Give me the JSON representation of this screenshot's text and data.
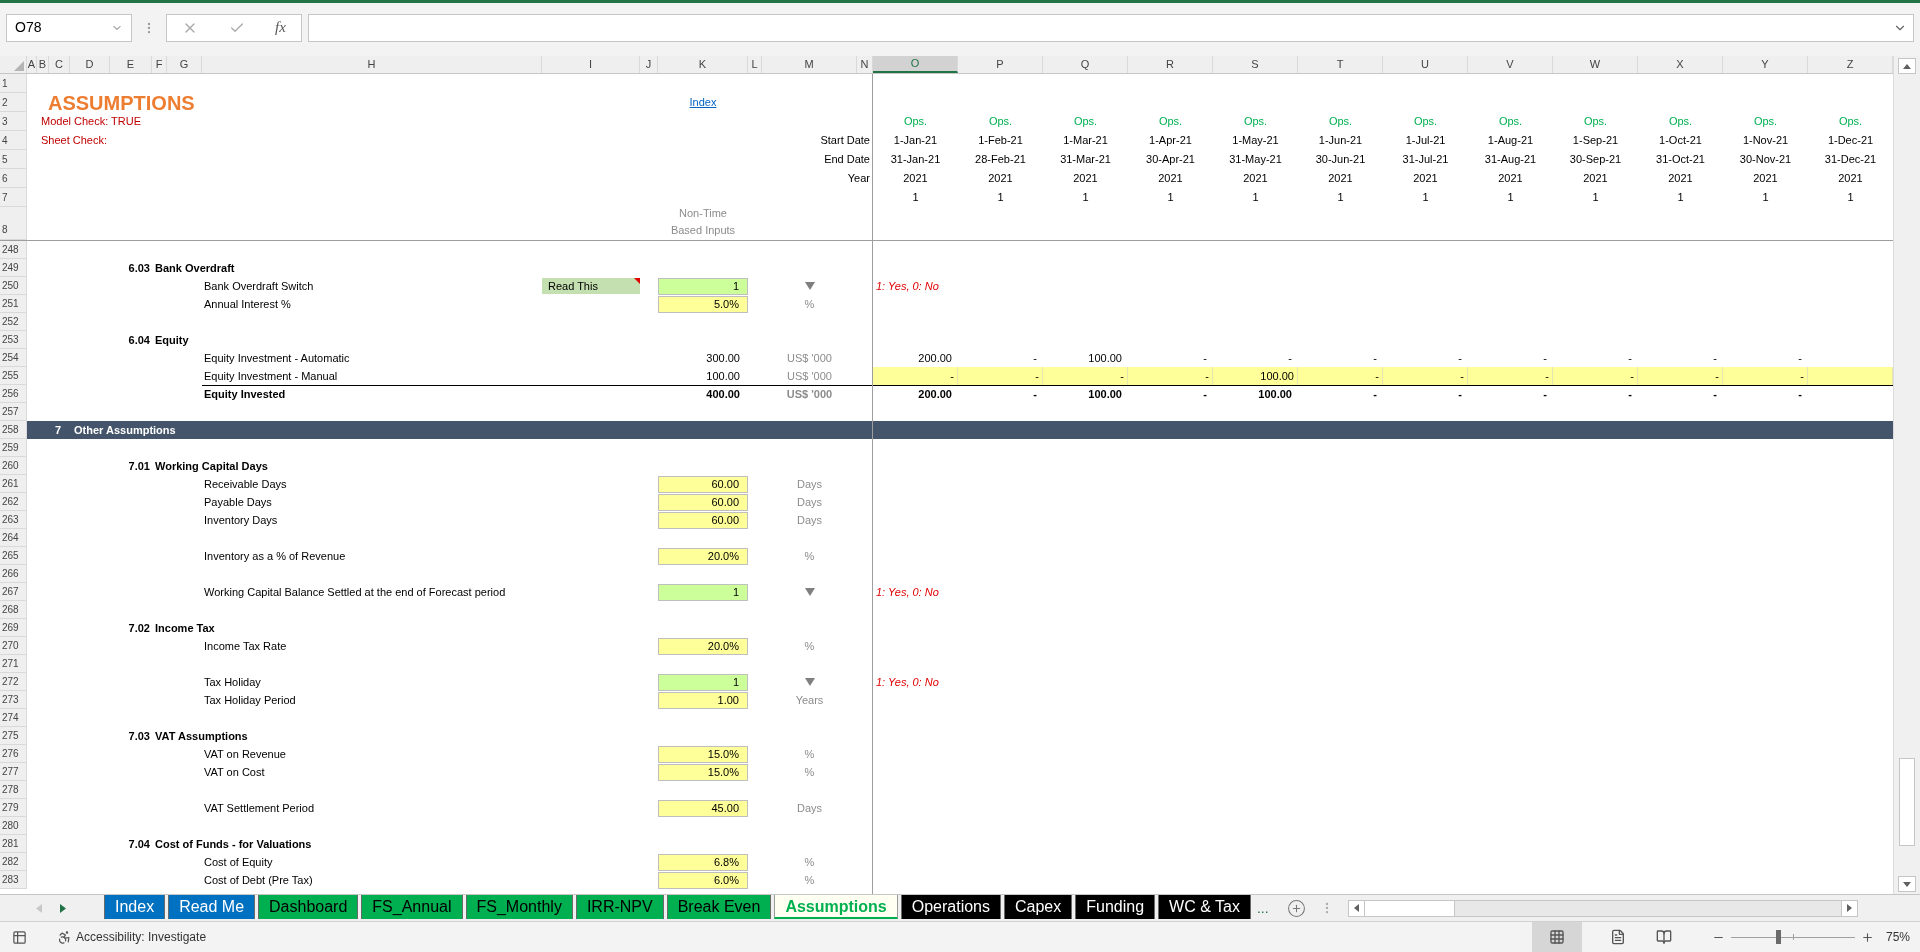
{
  "name_box": "O78",
  "function_button": "fx",
  "columns": [
    {
      "label": "A",
      "selected": false
    },
    {
      "label": "B",
      "selected": false
    },
    {
      "label": "C",
      "selected": false
    },
    {
      "label": "D",
      "selected": false
    },
    {
      "label": "E",
      "selected": false
    },
    {
      "label": "F",
      "selected": false
    },
    {
      "label": "G",
      "selected": false
    },
    {
      "label": "H",
      "selected": false
    },
    {
      "label": "I",
      "selected": false
    },
    {
      "label": "J",
      "selected": false
    },
    {
      "label": "K",
      "selected": false
    },
    {
      "label": "L",
      "selected": false
    },
    {
      "label": "M",
      "selected": false
    },
    {
      "label": "N",
      "selected": false
    },
    {
      "label": "O",
      "selected": true
    },
    {
      "label": "P",
      "selected": false
    },
    {
      "label": "Q",
      "selected": false
    },
    {
      "label": "R",
      "selected": false
    },
    {
      "label": "S",
      "selected": false
    },
    {
      "label": "T",
      "selected": false
    },
    {
      "label": "U",
      "selected": false
    },
    {
      "label": "V",
      "selected": false
    },
    {
      "label": "W",
      "selected": false
    },
    {
      "label": "X",
      "selected": false
    },
    {
      "label": "Y",
      "selected": false
    },
    {
      "label": "Z",
      "selected": false
    }
  ],
  "top_row_numbers": [
    "1",
    "2",
    "3",
    "4",
    "5",
    "6",
    "7",
    "8"
  ],
  "header": {
    "title": "ASSUMPTIONS",
    "model_check": "Model Check: TRUE",
    "sheet_check": "Sheet Check:",
    "index_link": "Index",
    "row_labels": [
      "Start Date",
      "End Date",
      "Year"
    ],
    "inputs_heading": "Non-Time Based Inputs"
  },
  "periods": [
    {
      "flag": "Ops.",
      "start": "1-Jan-21",
      "end": "31-Jan-21",
      "year": "2021",
      "counter": "1"
    },
    {
      "flag": "Ops.",
      "start": "1-Feb-21",
      "end": "28-Feb-21",
      "year": "2021",
      "counter": "1"
    },
    {
      "flag": "Ops.",
      "start": "1-Mar-21",
      "end": "31-Mar-21",
      "year": "2021",
      "counter": "1"
    },
    {
      "flag": "Ops.",
      "start": "1-Apr-21",
      "end": "30-Apr-21",
      "year": "2021",
      "counter": "1"
    },
    {
      "flag": "Ops.",
      "start": "1-May-21",
      "end": "31-May-21",
      "year": "2021",
      "counter": "1"
    },
    {
      "flag": "Ops.",
      "start": "1-Jun-21",
      "end": "30-Jun-21",
      "year": "2021",
      "counter": "1"
    },
    {
      "flag": "Ops.",
      "start": "1-Jul-21",
      "end": "31-Jul-21",
      "year": "2021",
      "counter": "1"
    },
    {
      "flag": "Ops.",
      "start": "1-Aug-21",
      "end": "31-Aug-21",
      "year": "2021",
      "counter": "1"
    },
    {
      "flag": "Ops.",
      "start": "1-Sep-21",
      "end": "30-Sep-21",
      "year": "2021",
      "counter": "1"
    },
    {
      "flag": "Ops.",
      "start": "1-Oct-21",
      "end": "31-Oct-21",
      "year": "2021",
      "counter": "1"
    },
    {
      "flag": "Ops.",
      "start": "1-Nov-21",
      "end": "30-Nov-21",
      "year": "2021",
      "counter": "1"
    },
    {
      "flag": "Ops.",
      "start": "1-Dec-21",
      "end": "31-Dec-21",
      "year": "2021",
      "counter": "1"
    }
  ],
  "rows": [
    {
      "number": "248",
      "kind": "blank"
    },
    {
      "number": "249",
      "kind": "subsection",
      "index": "6.03",
      "label": "Bank Overdraft"
    },
    {
      "number": "250",
      "kind": "switch",
      "label": "Bank Overdraft Switch",
      "button": {
        "label": "Read This",
        "has_comment": true
      },
      "value": "1",
      "note": "1: Yes, 0: No"
    },
    {
      "number": "251",
      "kind": "input",
      "label": "Annual Interest %",
      "value": "5.0%",
      "unit": "%"
    },
    {
      "number": "252",
      "kind": "blank"
    },
    {
      "number": "253",
      "kind": "subsection",
      "index": "6.04",
      "label": "Equity"
    },
    {
      "number": "254",
      "kind": "calc",
      "label": "Equity Investment - Automatic",
      "value": "300.00",
      "unit": "US$ '000",
      "monthly": [
        "200.00",
        "-",
        "100.00",
        "-",
        "-",
        "-",
        "-",
        "-",
        "-",
        "-",
        "-"
      ]
    },
    {
      "number": "255",
      "kind": "timeinput",
      "label": "Equity Investment - Manual",
      "value": "100.00",
      "unit": "US$ '000",
      "monthly": [
        "-",
        "-",
        "-",
        "-",
        "100.00",
        "-",
        "-",
        "-",
        "-",
        "-",
        "-"
      ]
    },
    {
      "number": "256",
      "kind": "total",
      "label": "Equity Invested",
      "value": "400.00",
      "unit": "US$ '000",
      "monthly": [
        "200.00",
        "-",
        "100.00",
        "-",
        "100.00",
        "-",
        "-",
        "-",
        "-",
        "-",
        "-"
      ]
    },
    {
      "number": "257",
      "kind": "blank"
    },
    {
      "number": "258",
      "kind": "section",
      "index": "7",
      "label": "Other Assumptions"
    },
    {
      "number": "259",
      "kind": "blank"
    },
    {
      "number": "260",
      "kind": "subsection",
      "index": "7.01",
      "label": "Working Capital Days"
    },
    {
      "number": "261",
      "kind": "input",
      "label": "Receivable Days",
      "value": "60.00",
      "unit": "Days"
    },
    {
      "number": "262",
      "kind": "input",
      "label": "Payable Days",
      "value": "60.00",
      "unit": "Days"
    },
    {
      "number": "263",
      "kind": "input",
      "label": "Inventory Days",
      "value": "60.00",
      "unit": "Days"
    },
    {
      "number": "264",
      "kind": "blank"
    },
    {
      "number": "265",
      "kind": "input",
      "label": "Inventory as a % of Revenue",
      "value": "20.0%",
      "unit": "%"
    },
    {
      "number": "266",
      "kind": "blank"
    },
    {
      "number": "267",
      "kind": "switch",
      "label": "Working Capital Balance Settled at the end of Forecast period",
      "value": "1",
      "note": "1: Yes, 0: No"
    },
    {
      "number": "268",
      "kind": "blank"
    },
    {
      "number": "269",
      "kind": "subsection",
      "index": "7.02",
      "label": "Income Tax"
    },
    {
      "number": "270",
      "kind": "input",
      "label": "Income Tax Rate",
      "value": "20.0%",
      "unit": "%"
    },
    {
      "number": "271",
      "kind": "blank"
    },
    {
      "number": "272",
      "kind": "switch",
      "label": "Tax Holiday",
      "value": "1",
      "note": "1: Yes, 0: No"
    },
    {
      "number": "273",
      "kind": "input",
      "label": "Tax Holiday Period",
      "value": "1.00",
      "unit": "Years"
    },
    {
      "number": "274",
      "kind": "blank"
    },
    {
      "number": "275",
      "kind": "subsection",
      "index": "7.03",
      "label": "VAT Assumptions"
    },
    {
      "number": "276",
      "kind": "input",
      "label": "VAT on Revenue",
      "value": "15.0%",
      "unit": "%"
    },
    {
      "number": "277",
      "kind": "input",
      "label": "VAT on Cost",
      "value": "15.0%",
      "unit": "%"
    },
    {
      "number": "278",
      "kind": "blank"
    },
    {
      "number": "279",
      "kind": "input",
      "label": "VAT Settlement Period",
      "value": "45.00",
      "unit": "Days"
    },
    {
      "number": "280",
      "kind": "blank"
    },
    {
      "number": "281",
      "kind": "subsection",
      "index": "7.04",
      "label": "Cost of Funds - for Valuations"
    },
    {
      "number": "282",
      "kind": "input",
      "label": "Cost of Equity",
      "value": "6.8%",
      "unit": "%"
    },
    {
      "number": "283",
      "kind": "input",
      "label": "Cost of Debt (Pre Tax)",
      "value": "6.0%",
      "unit": "%"
    }
  ],
  "sheet_tabs": [
    {
      "label": "Index",
      "color": "#0070c0",
      "selected": false
    },
    {
      "label": "Read Me",
      "color": "#0070c0",
      "selected": false
    },
    {
      "label": "Dashboard",
      "color": "#00b050",
      "selected": false
    },
    {
      "label": "FS_Annual",
      "color": "#00b050",
      "selected": false
    },
    {
      "label": "FS_Monthly",
      "color": "#00b050",
      "selected": false
    },
    {
      "label": "IRR-NPV",
      "color": "#00b050",
      "selected": false
    },
    {
      "label": "Break Even",
      "color": "#00b050",
      "selected": false
    },
    {
      "label": "Assumptions",
      "color": "#00b050",
      "selected": true
    },
    {
      "label": "Operations",
      "color": "#000000",
      "selected": false
    },
    {
      "label": "Capex",
      "color": "#000000",
      "selected": false
    },
    {
      "label": "Funding",
      "color": "#000000",
      "selected": false
    },
    {
      "label": "WC & Tax",
      "color": "#000000",
      "selected": false
    }
  ],
  "more_tabs": "...",
  "status": {
    "accessibility": "Accessibility: Investigate",
    "zoom": "75%",
    "zoom_slider": {
      "level": 0.36
    }
  }
}
